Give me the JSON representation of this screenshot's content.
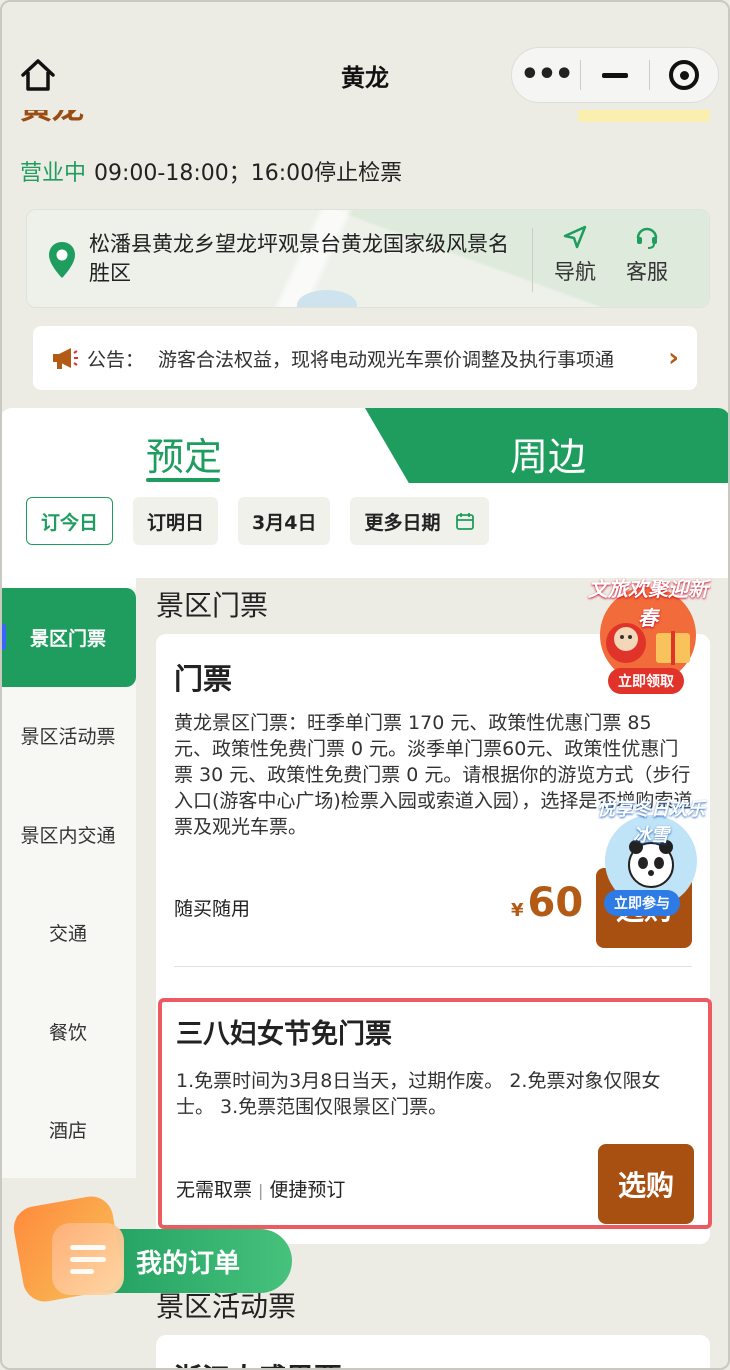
{
  "header": {
    "title": "黄龙",
    "partial_title": "黄龙"
  },
  "info": {
    "status": "营业中",
    "hours": "09:00-18:00；16:00停止检票",
    "address": "松潘县黄龙乡望龙坪观景台黄龙国家级风景名胜区",
    "nav_label": "导航",
    "service_label": "客服"
  },
  "notice": {
    "label": "公告：",
    "text": "游客合法权益，现将电动观光车票价调整及执行事项通"
  },
  "tabs": {
    "book": "预定",
    "around": "周边"
  },
  "dates": [
    "订今日",
    "订明日",
    "3月4日",
    "更多日期"
  ],
  "sidebar": {
    "items": [
      "景区门票",
      "景区活动票",
      "景区内交通",
      "交通",
      "餐饮",
      "酒店"
    ]
  },
  "content": {
    "section1_title": "景区门票",
    "ticket": {
      "name": "门票",
      "desc": "黄龙景区门票：旺季单门票 170 元、政策性优惠门票 85 元、政策性免费门票 0 元。淡季单门票60元、政策性优惠门票 30 元、政策性免费门票 0 元。请根据你的游览方式（步行入口(游客中心广场)检票入园或索道入园），选择是否增购索道票及观光车票。",
      "tag": "随买随用",
      "currency": "¥",
      "price": "60",
      "buy_label": "选购"
    },
    "special": {
      "name": "三八妇女节免门票",
      "desc": "1.免票时间为3月8日当天，过期作废。 2.免票对象仅限女士。 3.免票范围仅限景区门票。",
      "tag1": "无需取票",
      "tag_sep": "|",
      "tag2": "便捷预订",
      "buy_label": "选购"
    },
    "section2_title": "景区活动票",
    "next_card_partial": "浙江人感恩票"
  },
  "promos": {
    "promo1_title": "文旅欢聚迎新春",
    "promo1_btn": "立即领取",
    "promo2_title": "悦享冬日欢乐冰雪",
    "promo2_btn": "立即参与"
  },
  "order_fab": {
    "label": "我的订单"
  },
  "colors": {
    "brand_green": "#1f9d5e",
    "buy_brown": "#a84f12",
    "highlight_red": "#ee5a62",
    "page_bg": "#ecebe4"
  }
}
